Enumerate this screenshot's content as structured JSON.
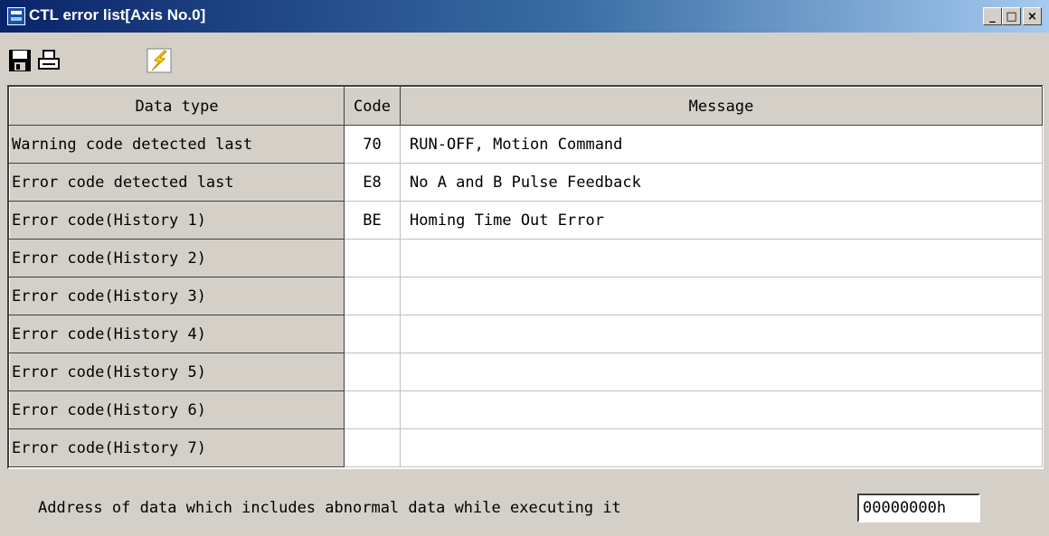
{
  "window": {
    "title": "CTL error list[Axis No.0]",
    "controls": {
      "minimize": "_",
      "maximize": "□",
      "close": "×"
    }
  },
  "toolbar": {
    "items": [
      {
        "name": "save",
        "icon": "save-icon"
      },
      {
        "name": "print",
        "icon": "print-icon"
      },
      {
        "name": "execute",
        "icon": "lightning-icon"
      }
    ]
  },
  "table": {
    "headers": {
      "data_type": "Data type",
      "code": "Code",
      "message": "Message"
    },
    "rows": [
      {
        "label": "Warning code detected last",
        "code": "70",
        "message": "RUN-OFF, Motion Command"
      },
      {
        "label": "Error code detected last",
        "code": "E8",
        "message": "No A and B Pulse Feedback"
      },
      {
        "label": "Error code(History 1)",
        "code": "BE",
        "message": "Homing Time Out Error"
      },
      {
        "label": "Error code(History 2)",
        "code": "",
        "message": ""
      },
      {
        "label": "Error code(History 3)",
        "code": "",
        "message": ""
      },
      {
        "label": "Error code(History 4)",
        "code": "",
        "message": ""
      },
      {
        "label": "Error code(History 5)",
        "code": "",
        "message": ""
      },
      {
        "label": "Error code(History 6)",
        "code": "",
        "message": ""
      },
      {
        "label": "Error code(History 7)",
        "code": "",
        "message": ""
      }
    ]
  },
  "footer": {
    "label": "Address of data which includes abnormal data while executing it",
    "address_value": "00000000h"
  },
  "colors": {
    "face": "#d4d0c8",
    "title_start": "#0a246a",
    "title_end": "#a6caf0",
    "lightning": "#ffd700"
  }
}
